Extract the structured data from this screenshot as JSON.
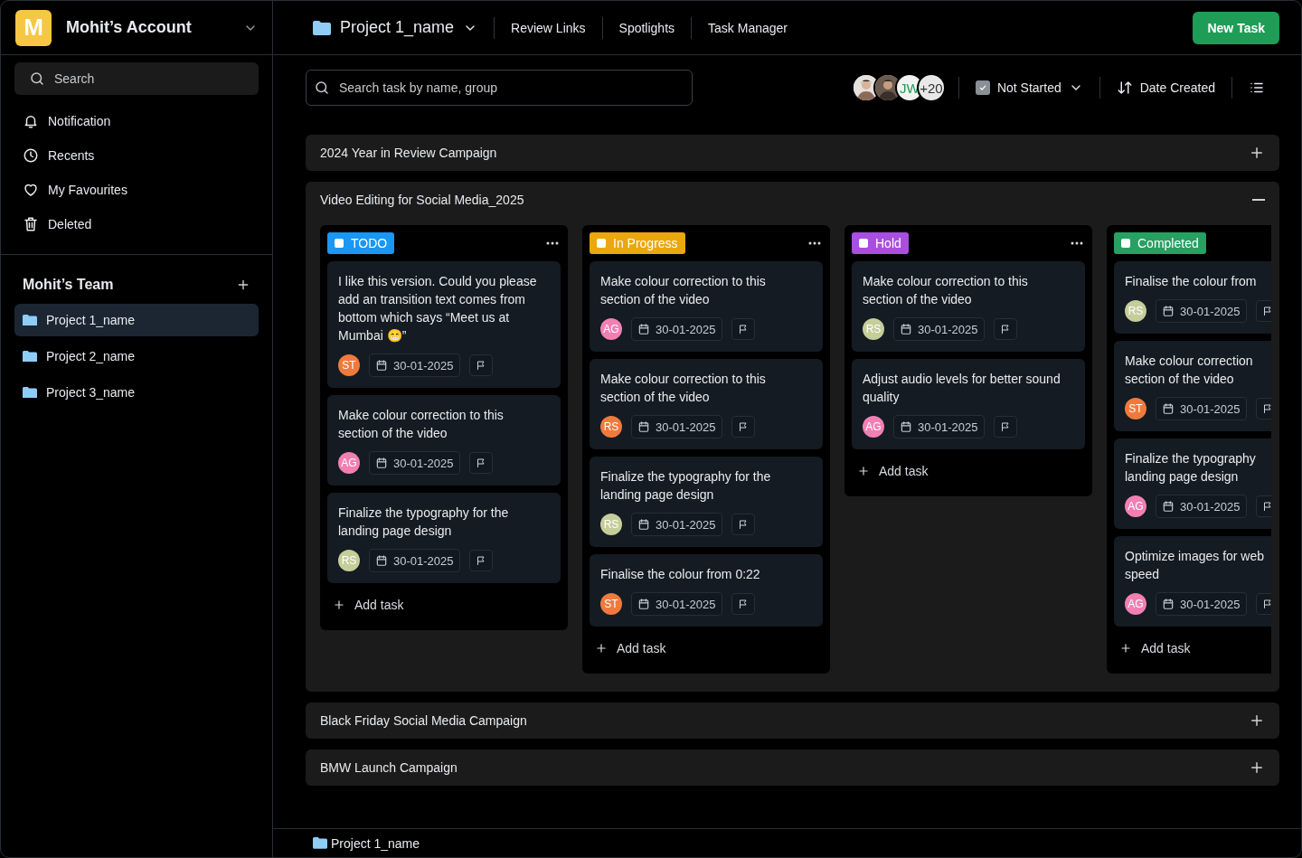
{
  "sidebar": {
    "account": {
      "initial": "M",
      "name": "Mohit’s Account"
    },
    "search": {
      "placeholder": "Search"
    },
    "nav": [
      {
        "label": "Notification"
      },
      {
        "label": "Recents"
      },
      {
        "label": "My Favourites"
      },
      {
        "label": "Deleted"
      }
    ],
    "team": {
      "title": "Mohit’s Team",
      "projects": [
        {
          "label": "Project 1_name",
          "selected": true
        },
        {
          "label": "Project 2_name",
          "selected": false
        },
        {
          "label": "Project 3_name",
          "selected": false
        }
      ]
    }
  },
  "topbar": {
    "project": "Project 1_name",
    "links": [
      "Review Links",
      "Spotlights",
      "Task Manager"
    ],
    "new_task": "New Task"
  },
  "toolbar": {
    "search": {
      "placeholder": "Search task by name, group"
    },
    "avatars": [
      {
        "kind": "picture"
      },
      {
        "kind": "picture"
      },
      {
        "kind": "initials",
        "text": "JW"
      },
      {
        "kind": "count",
        "text": "+20"
      }
    ],
    "filter": {
      "label": "Not Started",
      "checked": true
    },
    "sort": "Date Created"
  },
  "groups": [
    {
      "title": "2024 Year in Review Campaign",
      "expanded": false
    },
    {
      "title": "Video Editing for Social Media_2025",
      "expanded": true,
      "columns": [
        {
          "status": "TODO",
          "color": "#1a96f5",
          "has_menu": true,
          "clipped": false,
          "add_label": "Add task",
          "cards": [
            {
              "lines": [
                "I like this version. Could you please add an transition text comes from bottom which says “Meet us at Mumbai 😁”"
              ],
              "assignee": {
                "initials": "ST",
                "color": "#f07a3c"
              },
              "date": "30-01-2025"
            },
            {
              "lines": [
                "Make colour correction to this section of the video"
              ],
              "assignee": {
                "initials": "AG",
                "color": "#f27fb4"
              },
              "date": "30-01-2025"
            },
            {
              "lines": [
                "Finalize the typography for the landing page design"
              ],
              "assignee": {
                "initials": "RS",
                "color": "#c5cd9a"
              },
              "date": "30-01-2025"
            }
          ]
        },
        {
          "status": "In Progress",
          "color": "#eaa70f",
          "has_menu": true,
          "clipped": false,
          "add_label": "Add task",
          "cards": [
            {
              "lines": [
                "Make colour correction to this section of the video"
              ],
              "assignee": {
                "initials": "AG",
                "color": "#f27fb4"
              },
              "date": "30-01-2025"
            },
            {
              "lines": [
                "Make colour correction to this section of the video"
              ],
              "assignee": {
                "initials": "RS",
                "color": "#f07a3c"
              },
              "date": "30-01-2025"
            },
            {
              "lines": [
                "Finalize the typography for the landing page design"
              ],
              "assignee": {
                "initials": "RS",
                "color": "#c5cd9a"
              },
              "date": "30-01-2025"
            },
            {
              "lines": [
                "Finalise the colour from 0:22"
              ],
              "assignee": {
                "initials": "ST",
                "color": "#f07a3c"
              },
              "date": "30-01-2025"
            }
          ]
        },
        {
          "status": "Hold",
          "color": "#a84fe0",
          "has_menu": true,
          "clipped": false,
          "add_label": "Add task",
          "cards": [
            {
              "lines": [
                "Make colour correction to this section of the video"
              ],
              "assignee": {
                "initials": "RS",
                "color": "#c5cd9a"
              },
              "date": "30-01-2025"
            },
            {
              "lines": [
                "Adjust audio levels for better sound quality"
              ],
              "assignee": {
                "initials": "AG",
                "color": "#f27fb4"
              },
              "date": "30-01-2025"
            }
          ]
        },
        {
          "status": "Completed",
          "color": "#27a062",
          "has_menu": false,
          "clipped": true,
          "add_label": "Add task",
          "cards": [
            {
              "lines": [
                "Finalise the colour from"
              ],
              "assignee": {
                "initials": "RS",
                "color": "#c5cd9a"
              },
              "date": "30-01-2025"
            },
            {
              "lines": [
                "Make colour correction",
                "section of the video"
              ],
              "assignee": {
                "initials": "ST",
                "color": "#f07a3c"
              },
              "date": "30-01-2025"
            },
            {
              "lines": [
                "Finalize the typography",
                "landing page design"
              ],
              "assignee": {
                "initials": "AG",
                "color": "#f27fb4"
              },
              "date": "30-01-2025"
            },
            {
              "lines": [
                "Optimize images for web",
                "speed"
              ],
              "assignee": {
                "initials": "AG",
                "color": "#f27fb4"
              },
              "date": "30-01-2025"
            }
          ]
        }
      ]
    },
    {
      "title": "Black Friday Social Media Campaign",
      "expanded": false
    },
    {
      "title": "BMW Launch Campaign",
      "expanded": false
    }
  ],
  "footer": {
    "breadcrumb": "Project 1_name"
  }
}
